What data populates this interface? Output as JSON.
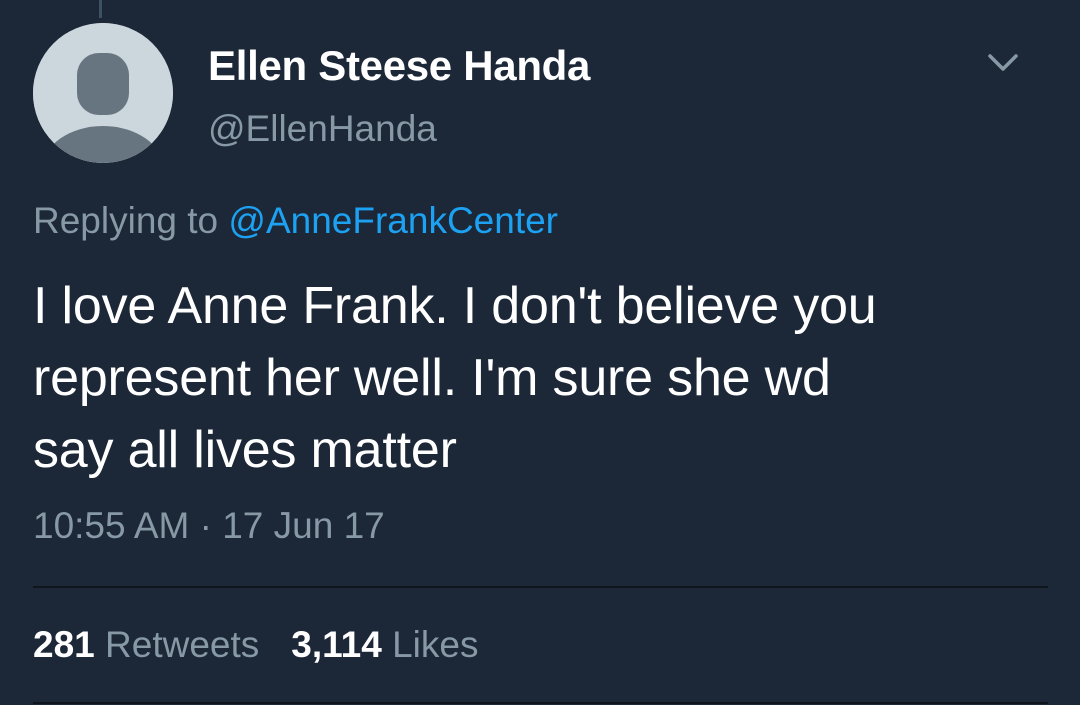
{
  "author": {
    "display_name": "Ellen Steese Handa",
    "handle": "@EllenHanda",
    "avatar": "default-egg-avatar-icon"
  },
  "reply": {
    "prefix": "Replying to",
    "mention": "@AnneFrankCenter"
  },
  "tweet": {
    "lines": [
      "I love Anne Frank. I don't believe you",
      "represent her well. I'm sure she wd",
      "say all lives matter"
    ],
    "timestamp": "10:55 AM · 17 Jun 17"
  },
  "stats": {
    "retweets_count": "281",
    "retweets_label": "Retweets",
    "likes_count": "3,114",
    "likes_label": "Likes"
  },
  "icons": {
    "menu": "chevron-down-icon"
  },
  "colors": {
    "background": "#1c2837",
    "secondary_text": "#8899a6",
    "link": "#1da1f2"
  }
}
